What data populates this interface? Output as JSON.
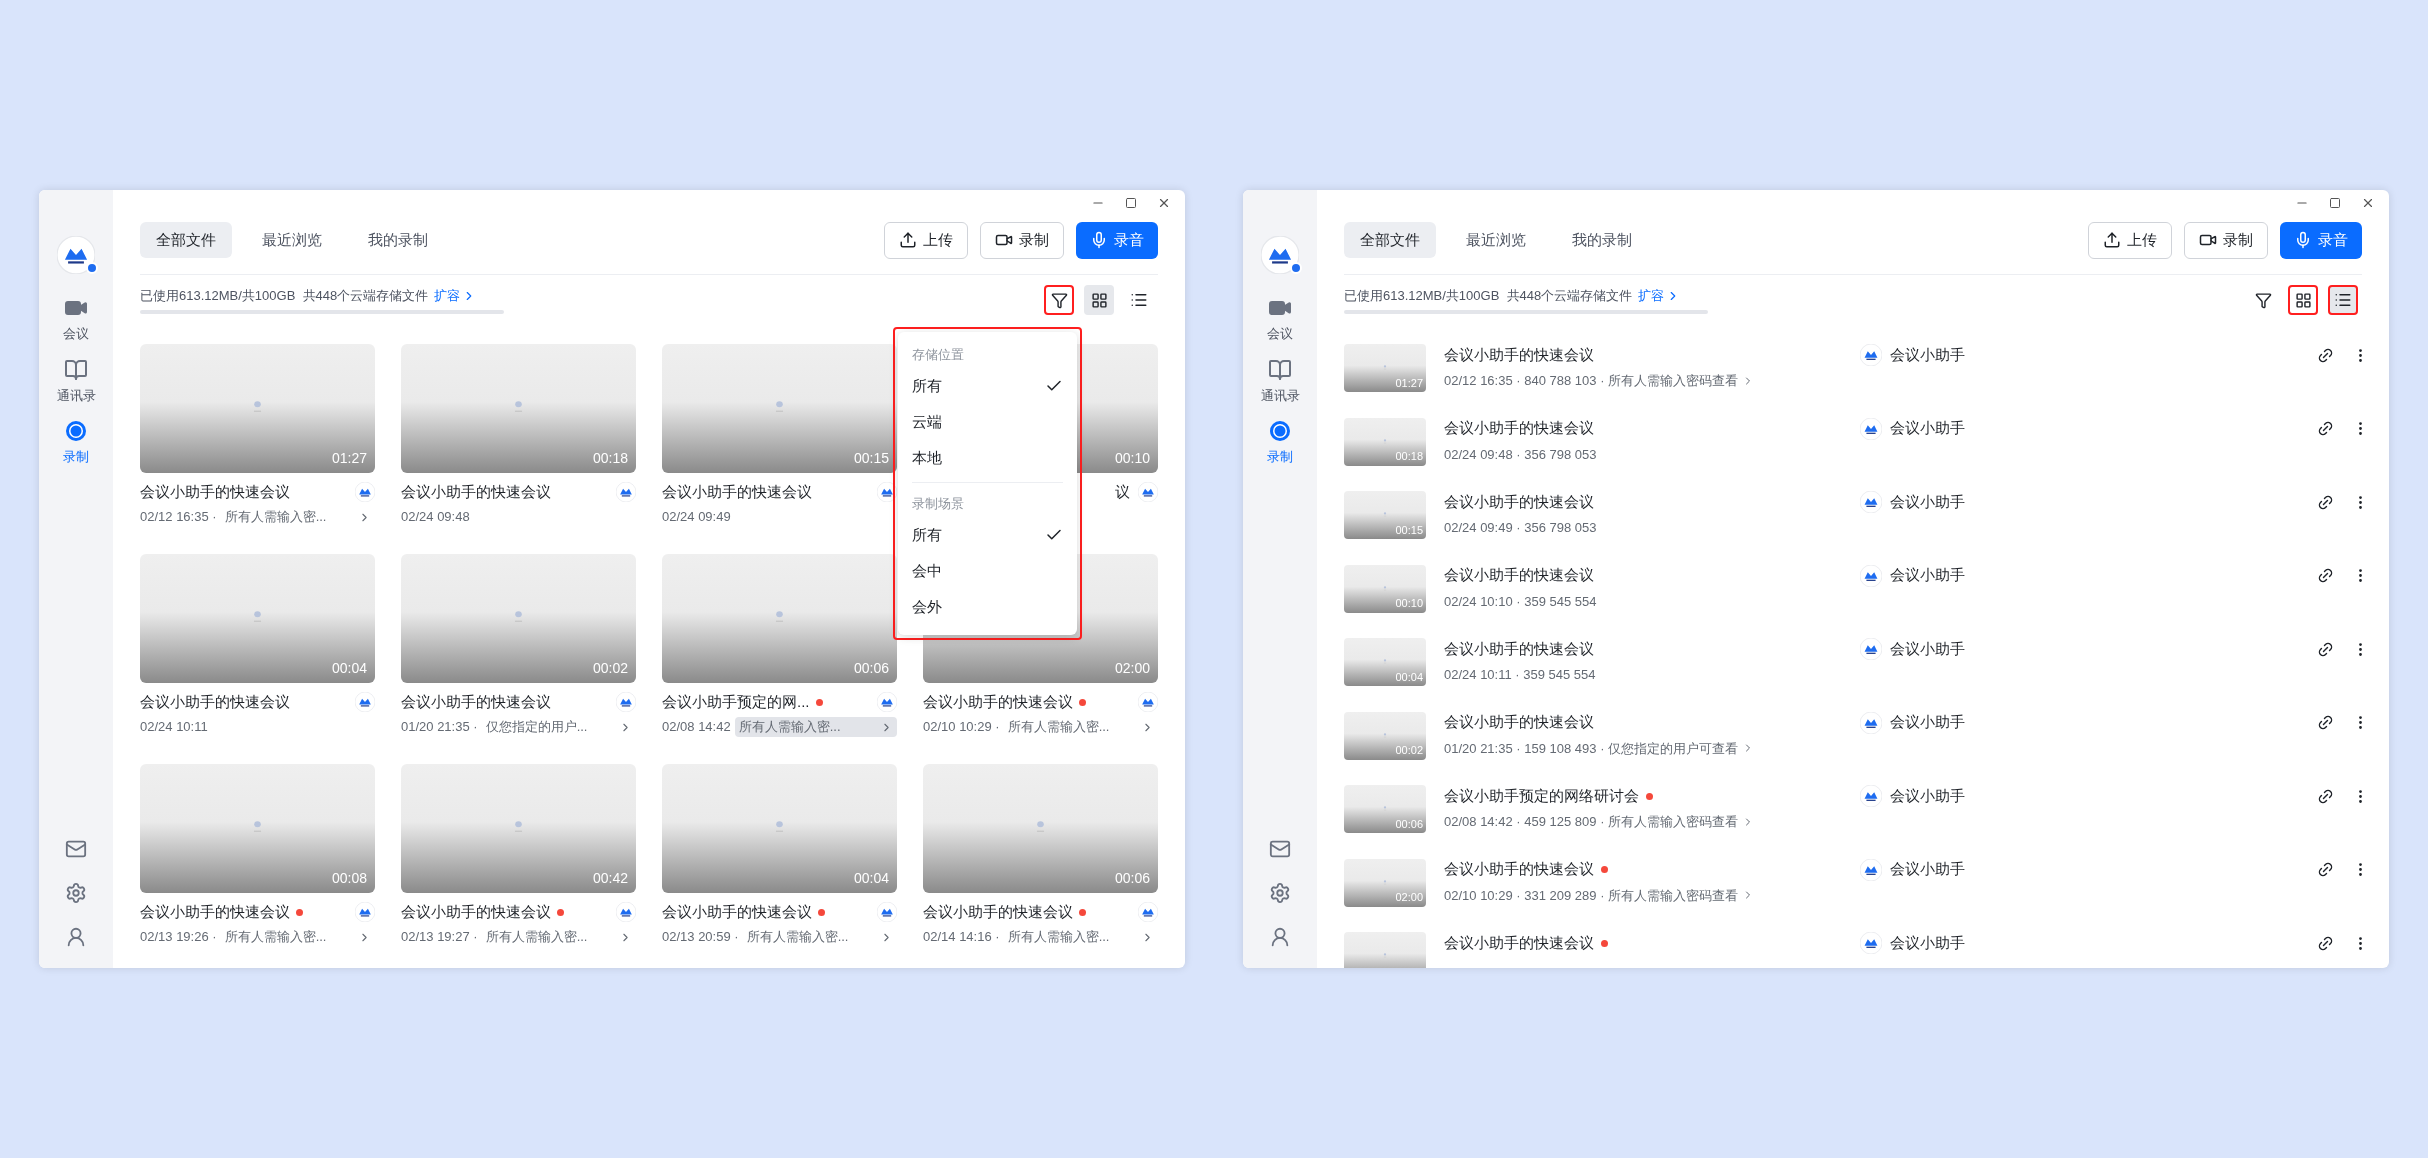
{
  "windows": [
    {
      "sidebar": {
        "items": [
          {
            "label": "会议",
            "kind": "meeting",
            "selected": false
          },
          {
            "label": "通讯录",
            "kind": "contacts",
            "selected": false
          },
          {
            "label": "录制",
            "kind": "record",
            "selected": true
          }
        ]
      },
      "tabs": [
        {
          "label": "全部文件",
          "selected": true
        },
        {
          "label": "最近浏览",
          "selected": false
        },
        {
          "label": "我的录制",
          "selected": false
        }
      ],
      "actions": [
        {
          "label": "上传",
          "kind": "upload"
        },
        {
          "label": "录制",
          "kind": "video"
        },
        {
          "label": "录音",
          "kind": "audio"
        }
      ],
      "storage": {
        "text": "已使用613.12MB/共100GB  共448个云端存储文件",
        "link": "扩容"
      },
      "view_tools": [
        {
          "kind": "filter",
          "selected": false,
          "highlighted": true
        },
        {
          "kind": "grid",
          "selected": true,
          "highlighted": false
        },
        {
          "kind": "list",
          "selected": false,
          "highlighted": false
        }
      ],
      "filter_menu": {
        "highlighted": true,
        "sections": [
          {
            "title": "存储位置",
            "options": [
              {
                "label": "所有",
                "checked": true
              },
              {
                "label": "云端",
                "checked": false
              },
              {
                "label": "本地",
                "checked": false
              }
            ]
          },
          {
            "title": "录制场景",
            "options": [
              {
                "label": "所有",
                "checked": true
              },
              {
                "label": "会中",
                "checked": false
              },
              {
                "label": "会外",
                "checked": false
              }
            ]
          }
        ]
      },
      "files": [
        {
          "kind": "card",
          "title": "会议小助手的快速会议",
          "dot": false,
          "duration": "01:27",
          "meta": "02/12 16:35 ·",
          "access": "所有人需输入密...",
          "hover": false
        },
        {
          "kind": "card",
          "title": "会议小助手的快速会议",
          "dot": false,
          "duration": "00:18",
          "meta": "02/24 09:48"
        },
        {
          "kind": "card",
          "title": "会议小助手的快速会议",
          "dot": false,
          "duration": "00:15",
          "meta": "02/24 09:49"
        },
        {
          "kind": "partial",
          "title": "议",
          "dot": false,
          "duration": "00:10"
        },
        {
          "kind": "card",
          "title": "会议小助手的快速会议",
          "dot": false,
          "duration": "00:04",
          "meta": "02/24 10:11"
        },
        {
          "kind": "card",
          "title": "会议小助手的快速会议",
          "dot": false,
          "duration": "00:02",
          "meta": "01/20 21:35 ·",
          "access": "仅您指定的用户...",
          "hover": false
        },
        {
          "kind": "card",
          "title": "会议小助手预定的网...",
          "dot": true,
          "duration": "00:06",
          "meta": "02/08 14:42",
          "access": "所有人需输入密...",
          "hover": true
        },
        {
          "kind": "card",
          "title": "会议小助手的快速会议",
          "dot": true,
          "duration": "02:00",
          "meta": "02/10 10:29 ·",
          "access": "所有人需输入密...",
          "hover": false
        },
        {
          "kind": "card",
          "title": "会议小助手的快速会议",
          "dot": true,
          "duration": "00:08",
          "meta": "02/13 19:26 ·",
          "access": "所有人需输入密...",
          "hover": false
        },
        {
          "kind": "card",
          "title": "会议小助手的快速会议",
          "dot": true,
          "duration": "00:42",
          "meta": "02/13 19:27 ·",
          "access": "所有人需输入密...",
          "hover": false
        },
        {
          "kind": "card",
          "title": "会议小助手的快速会议",
          "dot": true,
          "duration": "00:04",
          "meta": "02/13 20:59 ·",
          "access": "所有人需输入密...",
          "hover": false
        },
        {
          "kind": "card",
          "title": "会议小助手的快速会议",
          "dot": true,
          "duration": "00:06",
          "meta": "02/14 14:16 ·",
          "access": "所有人需输入密...",
          "hover": false
        }
      ]
    },
    {
      "sidebar": {
        "items": [
          {
            "label": "会议",
            "kind": "meeting",
            "selected": false
          },
          {
            "label": "通讯录",
            "kind": "contacts",
            "selected": false
          },
          {
            "label": "录制",
            "kind": "record",
            "selected": true
          }
        ]
      },
      "tabs": [
        {
          "label": "全部文件",
          "selected": true
        },
        {
          "label": "最近浏览",
          "selected": false
        },
        {
          "label": "我的录制",
          "selected": false
        }
      ],
      "actions": [
        {
          "label": "上传",
          "kind": "upload"
        },
        {
          "label": "录制",
          "kind": "video"
        },
        {
          "label": "录音",
          "kind": "audio"
        }
      ],
      "storage": {
        "text": "已使用613.12MB/共100GB  共448个云端存储文件",
        "link": "扩容"
      },
      "view_tools": [
        {
          "kind": "filter",
          "selected": false,
          "highlighted": false
        },
        {
          "kind": "grid",
          "selected": false,
          "highlighted": true
        },
        {
          "kind": "list",
          "selected": true,
          "highlighted": true
        }
      ],
      "files": [
        {
          "kind": "row",
          "title": "会议小助手的快速会议",
          "dot": false,
          "duration": "01:27",
          "meta": "02/12 16:35 · 840 788 103 ·",
          "access": "所有人需输入密码查看",
          "owner": "会议小助手"
        },
        {
          "kind": "row",
          "title": "会议小助手的快速会议",
          "dot": false,
          "duration": "00:18",
          "meta": "02/24 09:48 · 356 798 053",
          "owner": "会议小助手"
        },
        {
          "kind": "row",
          "title": "会议小助手的快速会议",
          "dot": false,
          "duration": "00:15",
          "meta": "02/24 09:49 · 356 798 053",
          "owner": "会议小助手"
        },
        {
          "kind": "row",
          "title": "会议小助手的快速会议",
          "dot": false,
          "duration": "00:10",
          "meta": "02/24 10:10 · 359 545 554",
          "owner": "会议小助手"
        },
        {
          "kind": "row",
          "title": "会议小助手的快速会议",
          "dot": false,
          "duration": "00:04",
          "meta": "02/24 10:11 · 359 545 554",
          "owner": "会议小助手"
        },
        {
          "kind": "row",
          "title": "会议小助手的快速会议",
          "dot": false,
          "duration": "00:02",
          "meta": "01/20 21:35 · 159 108 493 ·",
          "access": "仅您指定的用户可查看",
          "owner": "会议小助手"
        },
        {
          "kind": "row",
          "title": "会议小助手预定的网络研讨会",
          "dot": true,
          "duration": "00:06",
          "meta": "02/08 14:42 · 459 125 809 ·",
          "access": "所有人需输入密码查看",
          "owner": "会议小助手"
        },
        {
          "kind": "row",
          "title": "会议小助手的快速会议",
          "dot": true,
          "duration": "02:00",
          "meta": "02/10 10:29 · 331 209 289 ·",
          "access": "所有人需输入密码查看",
          "owner": "会议小助手"
        },
        {
          "kind": "row",
          "title": "会议小助手的快速会议",
          "dot": true,
          "owner": "会议小助手"
        }
      ]
    }
  ]
}
